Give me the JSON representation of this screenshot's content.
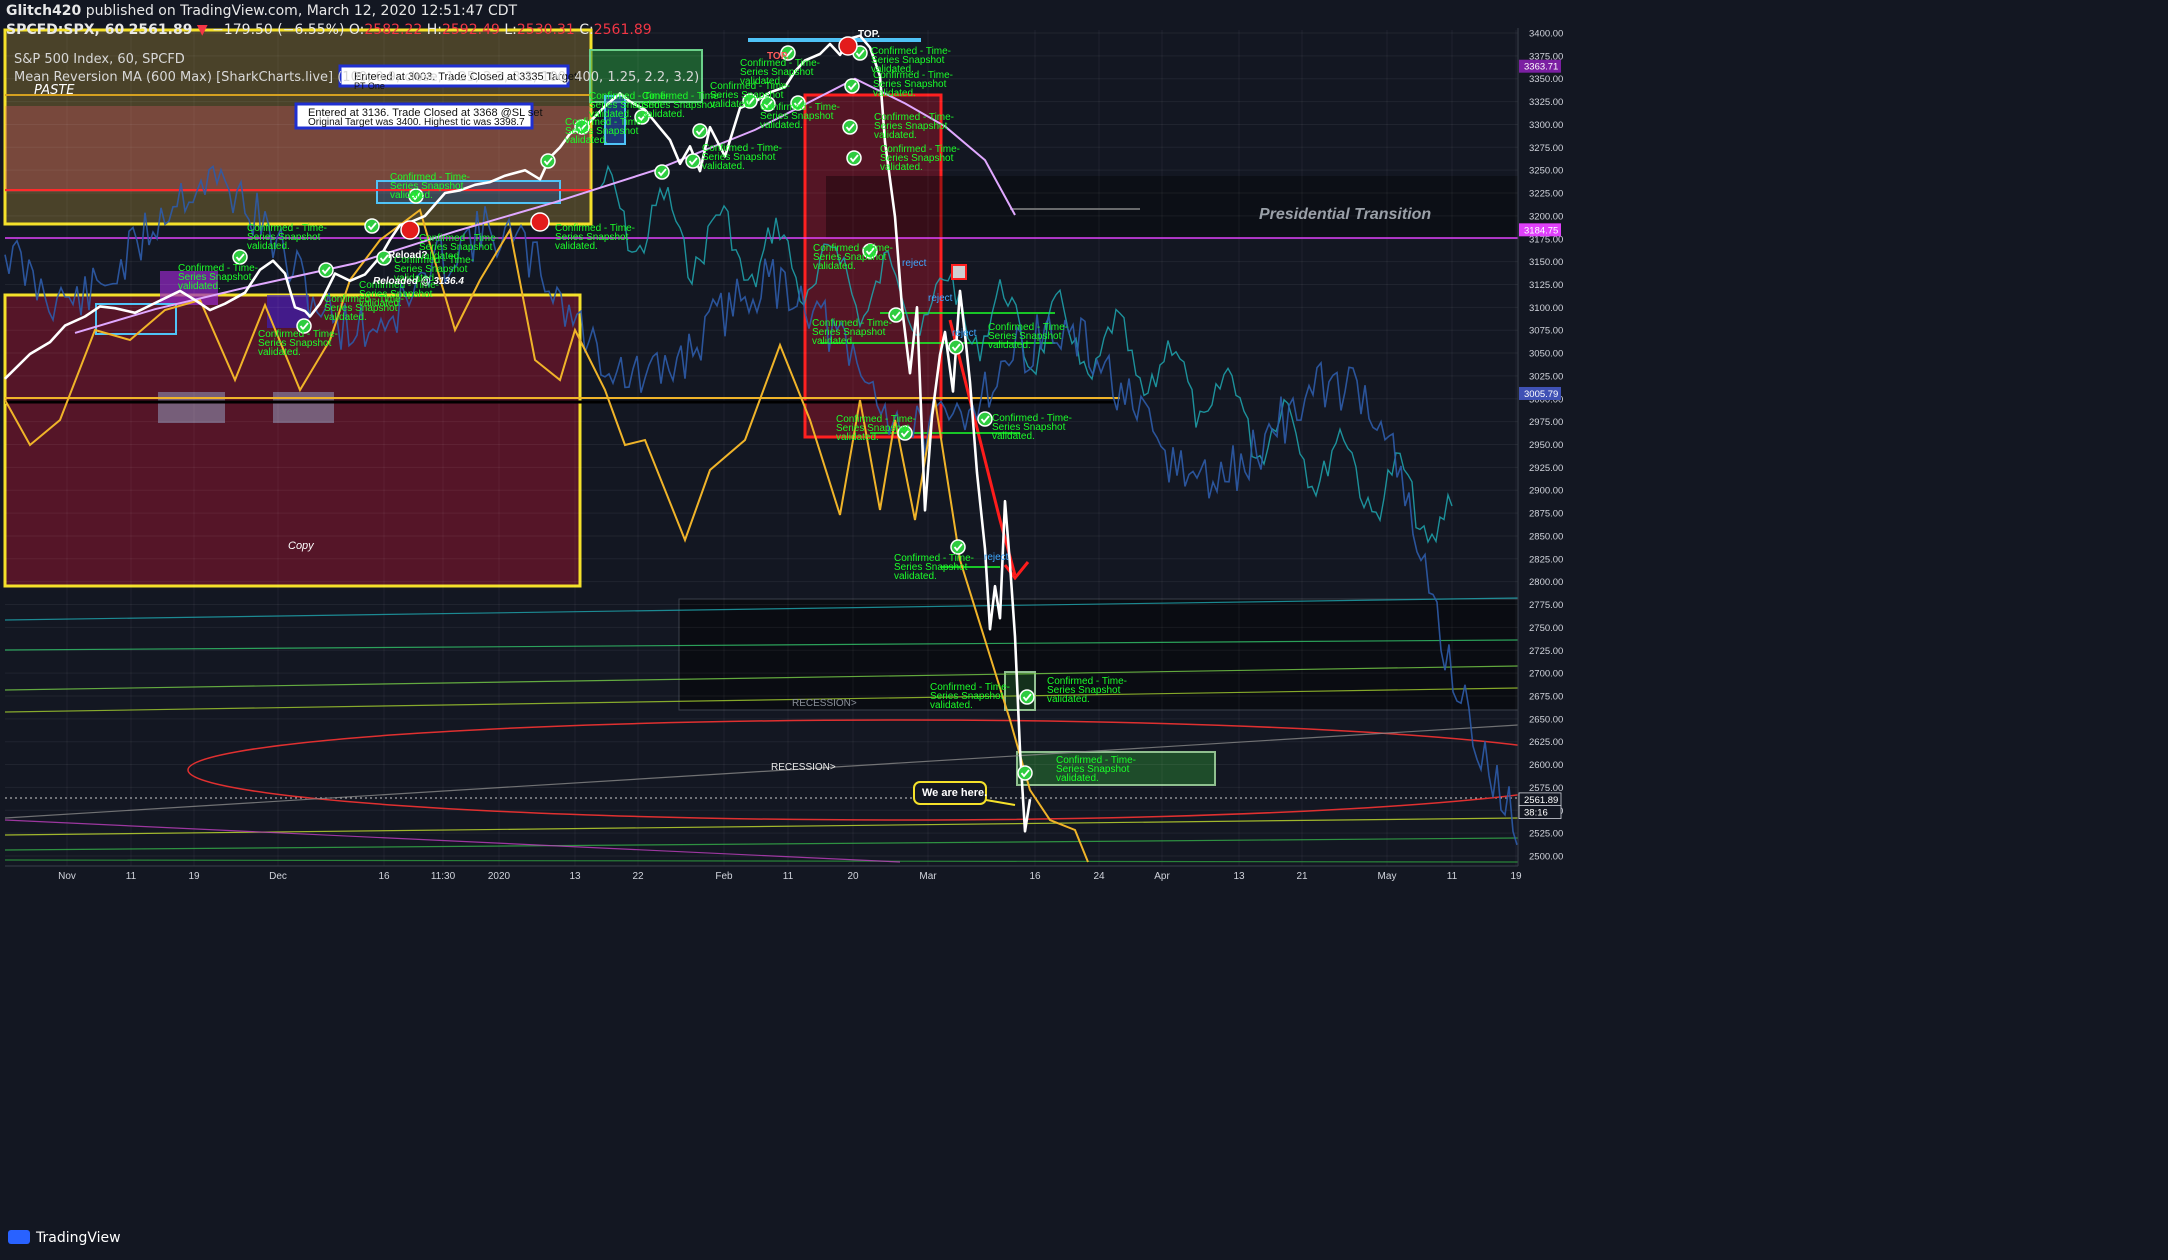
{
  "header": {
    "author": "Glitch420",
    "published_text": "published on TradingView.com, March 12, 2020 12:51:47 CDT",
    "symbol": "SPCFD:SPX, 60",
    "last_price": "2561.89",
    "change": "−179.50 (−6.55%)",
    "o_label": "O:",
    "o": "2582.22",
    "h_label": "H:",
    "h": "2592.49",
    "l_label": "L:",
    "l": "2530.31",
    "c_label": "C:",
    "c": "2561.89"
  },
  "chart_title": "S&P 500 Index, 60, SPCFD",
  "indicator_label": "Mean Reversion MA (600 Max) [SharkCharts.live] (100, 0.9, close, 1.25, 2.2, 3.2, 100, 400, 1.25, 2.2, 3.2)",
  "paste_label": "PASTE",
  "copy_label": "Copy",
  "brand": "TradingView",
  "colors": {
    "background": "#131722",
    "price": "#ffffff",
    "mean_reversion": "#e0a8ff",
    "cyan_projection": "#1fa7b0",
    "blue_projection": "#2d5ba8",
    "orange_oscillator": "#f0b429",
    "annotation_green": "#1bff29",
    "box_red": "#ff2020",
    "box_yellow": "#f5e12a",
    "price_tag_down": "#f23645"
  },
  "annotations": {
    "confirmed_1": "Confirmed - Time-",
    "confirmed_2": "Series Snapshot",
    "confirmed_3": "validated.",
    "note_3003_a": "Entered at 3003. Trade Closed  at 3335 Target.",
    "note_3003_b": "PT One",
    "note_3136_a": "Entered at 3136. Trade Closed at 3368 @SL  set",
    "note_3136_b": "Original Target was 3400. Highest tic was 3398.7",
    "presidential": "Presidential Transition",
    "recession_1": "RECESSION>",
    "recession_2": "RECESSION>",
    "we_are_here": "We are here.",
    "reload": "Reload?",
    "reloaded": "Reloaded @ 3136.4",
    "top_1": "TOP.",
    "top_2": "TOP.",
    "reject_1": "reject",
    "reject_2": "reject",
    "reject_3": "reject",
    "reject_4": "reject"
  },
  "price_tags": [
    {
      "label": "3363.71",
      "color": "#7b1fa2"
    },
    {
      "label": "3184.75",
      "color": "#e040fb"
    },
    {
      "label": "3005.79",
      "color": "#3f51b5"
    },
    {
      "label": "2561.89",
      "color": "#131722"
    },
    {
      "label": "38:16",
      "color": "#131722"
    }
  ],
  "chart_data": {
    "type": "line",
    "title": "S&P 500 Index, 60, SPCFD",
    "xlabel": "",
    "ylabel": "",
    "ylim": [
      2495,
      3410
    ],
    "y_ticks": [
      3400,
      3375,
      3350,
      3325,
      3300,
      3275,
      3250,
      3225,
      3200,
      3175,
      3150,
      3125,
      3100,
      3075,
      3050,
      3025,
      3000,
      2975,
      2950,
      2925,
      2900,
      2875,
      2850,
      2825,
      2800,
      2775,
      2750,
      2725,
      2700,
      2675,
      2650,
      2625,
      2600,
      2575,
      2550,
      2525,
      2500
    ],
    "x_ticks": [
      "Nov",
      "11",
      "19",
      "Dec",
      "16",
      "11:30",
      "2020",
      "13",
      "22",
      "Feb",
      "11",
      "20",
      "Mar",
      "16",
      "24",
      "Apr",
      "13",
      "21",
      "May",
      "11",
      "19"
    ],
    "grid": true,
    "series": [
      {
        "name": "SPX",
        "values": [
          [
            0,
            3022
          ],
          [
            25,
            3049
          ],
          [
            45,
            3062
          ],
          [
            60,
            3080
          ],
          [
            80,
            3090
          ],
          [
            95,
            3101
          ],
          [
            110,
            3099
          ],
          [
            130,
            3094
          ],
          [
            145,
            3102
          ],
          [
            160,
            3110
          ],
          [
            175,
            3118
          ],
          [
            190,
            3108
          ],
          [
            205,
            3097
          ],
          [
            220,
            3104
          ],
          [
            240,
            3116
          ],
          [
            255,
            3141
          ],
          [
            268,
            3151
          ],
          [
            280,
            3137
          ],
          [
            290,
            3100
          ],
          [
            300,
            3096
          ],
          [
            305,
            3090
          ],
          [
            315,
            3104
          ],
          [
            330,
            3137
          ],
          [
            345,
            3129
          ],
          [
            360,
            3136
          ],
          [
            375,
            3155
          ],
          [
            385,
            3174
          ],
          [
            395,
            3190
          ],
          [
            405,
            3193
          ],
          [
            420,
            3200
          ],
          [
            440,
            3225
          ],
          [
            455,
            3228
          ],
          [
            470,
            3234
          ],
          [
            485,
            3237
          ],
          [
            500,
            3244
          ],
          [
            520,
            3250
          ],
          [
            535,
            3240
          ],
          [
            545,
            3264
          ],
          [
            555,
            3275
          ],
          [
            565,
            3290
          ],
          [
            585,
            3303
          ],
          [
            600,
            3320
          ],
          [
            615,
            3334
          ],
          [
            625,
            3325
          ],
          [
            640,
            3316
          ],
          [
            655,
            3296
          ],
          [
            665,
            3283
          ],
          [
            675,
            3257
          ],
          [
            685,
            3276
          ],
          [
            695,
            3249
          ],
          [
            705,
            3297
          ],
          [
            720,
            3265
          ],
          [
            735,
            3318
          ],
          [
            750,
            3325
          ],
          [
            765,
            3335
          ],
          [
            780,
            3341
          ],
          [
            790,
            3358
          ],
          [
            800,
            3370
          ],
          [
            815,
            3377
          ],
          [
            825,
            3388
          ],
          [
            835,
            3376
          ],
          [
            845,
            3394
          ],
          [
            855,
            3397
          ],
          [
            865,
            3384
          ],
          [
            875,
            3353
          ],
          [
            880,
            3281
          ],
          [
            890,
            3199
          ],
          [
            897,
            3100
          ],
          [
            905,
            3028
          ],
          [
            912,
            3100
          ],
          [
            920,
            2878
          ],
          [
            927,
            2981
          ],
          [
            935,
            3048
          ],
          [
            940,
            3073
          ],
          [
            948,
            3008
          ],
          [
            955,
            3118
          ],
          [
            960,
            3070
          ],
          [
            965,
            3018
          ],
          [
            972,
            2919
          ],
          [
            980,
            2836
          ],
          [
            985,
            2748
          ],
          [
            990,
            2795
          ],
          [
            995,
            2760
          ],
          [
            1000,
            2888
          ],
          [
            1005,
            2819
          ],
          [
            1010,
            2740
          ],
          [
            1015,
            2616
          ],
          [
            1020,
            2527
          ],
          [
            1025,
            2562
          ]
        ]
      },
      {
        "name": "Mean Reversion MA",
        "values": [
          [
            70,
            3072
          ],
          [
            150,
            3098
          ],
          [
            250,
            3124
          ],
          [
            350,
            3148
          ],
          [
            450,
            3183
          ],
          [
            550,
            3215
          ],
          [
            650,
            3250
          ],
          [
            750,
            3294
          ],
          [
            850,
            3350
          ],
          [
            900,
            3323
          ],
          [
            940,
            3298
          ],
          [
            980,
            3261
          ],
          [
            1010,
            3201
          ]
        ]
      }
    ]
  }
}
